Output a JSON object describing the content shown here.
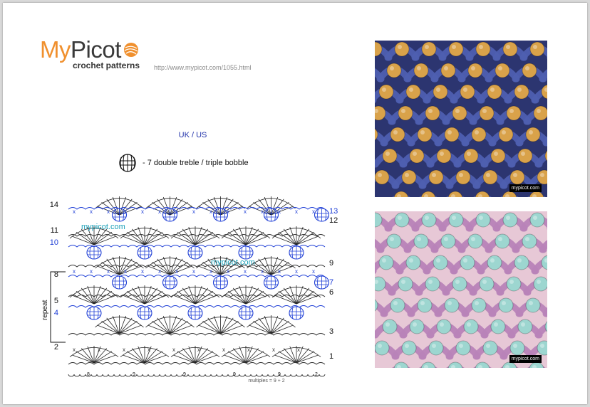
{
  "logo": {
    "my": "My",
    "picot": "Picot",
    "subtitle": "crochet patterns"
  },
  "url": "http://www.mypicot.com/1055.html",
  "header": {
    "convention": "UK / US"
  },
  "legend": {
    "symbol_icon": "bobble-icon",
    "text": "-  7 double treble / triple bobble"
  },
  "diagram": {
    "left_row_numbers": [
      "14",
      "11",
      "10",
      "8",
      "5",
      "4",
      "2"
    ],
    "right_row_numbers": [
      "13",
      "12",
      "9",
      "7",
      "6",
      "3",
      "1"
    ],
    "blue_rows": [
      "4",
      "7",
      "10",
      "13"
    ],
    "repeat_label": "repeat",
    "bottom_counts": [
      "8",
      "9",
      "9",
      "9",
      "9",
      "2"
    ],
    "multiples": "multiples = 9 + 2",
    "watermarks": [
      "mypicot.com",
      "mypicot.com"
    ]
  },
  "photos": [
    {
      "watermark": "mypicot.com",
      "base_color": "#4e5fb0",
      "bobble_color": "#d9a24a"
    },
    {
      "watermark": "mypicot.com",
      "base_color": "#b883b8",
      "bobble_color": "#9dd6d0"
    }
  ],
  "colors": {
    "logo_orange": "#f0902e",
    "diagram_blue": "#1f3fd6",
    "watermark_teal": "#1aa0b8"
  }
}
